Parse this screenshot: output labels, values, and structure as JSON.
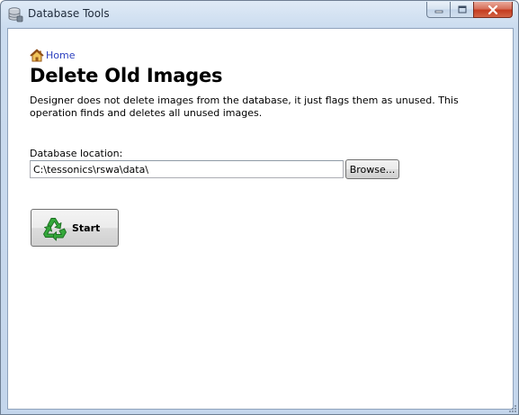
{
  "window": {
    "title": "Database Tools",
    "app_icon": "database-icon",
    "caption_buttons": [
      "minimize",
      "maximize",
      "close"
    ]
  },
  "breadcrumb": {
    "home_label": "Home",
    "home_icon": "home-icon"
  },
  "page": {
    "title": "Delete Old Images",
    "description": "Designer does not delete images from the database, it just flags them as unused. This operation finds and deletes all unused images."
  },
  "database": {
    "label": "Database location:",
    "path": "C:\\tessonics\\rswa\\data\\",
    "browse_label": "Browse..."
  },
  "actions": {
    "start_label": "Start",
    "start_icon": "recycle-icon"
  },
  "colors": {
    "link": "#2b3fbf",
    "recycle_green": "#2e9e35",
    "close_red": "#c43c1f"
  }
}
